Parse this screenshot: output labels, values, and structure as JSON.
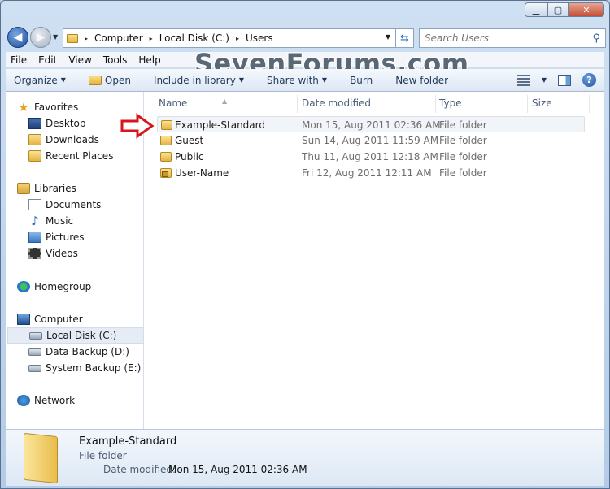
{
  "window": {
    "min_glyph": "▁",
    "max_glyph": "▢",
    "close_glyph": "✕"
  },
  "nav": {
    "back_glyph": "◀",
    "forward_glyph": "▶"
  },
  "address": {
    "crumbs": [
      "Computer",
      "Local Disk (C:)",
      "Users"
    ],
    "separator": "▸"
  },
  "search": {
    "placeholder": "Search Users"
  },
  "menu": [
    "File",
    "Edit",
    "View",
    "Tools",
    "Help"
  ],
  "watermark": "SevenForums.com",
  "toolbar": {
    "organize": "Organize",
    "open": "Open",
    "include": "Include in library",
    "share": "Share with",
    "burn": "Burn",
    "new_folder": "New folder",
    "help": "?"
  },
  "navpane": {
    "favorites": "Favorites",
    "desktop": "Desktop",
    "downloads": "Downloads",
    "recent": "Recent Places",
    "libraries": "Libraries",
    "documents": "Documents",
    "music": "Music",
    "pictures": "Pictures",
    "videos": "Videos",
    "homegroup": "Homegroup",
    "computer": "Computer",
    "local_disk": "Local Disk (C:)",
    "data_backup": "Data Backup (D:)",
    "system_backup": "System Backup (E:)",
    "network": "Network"
  },
  "columns": {
    "name": "Name",
    "date": "Date modified",
    "type": "Type",
    "size": "Size"
  },
  "files": [
    {
      "name": "Example-Standard",
      "date": "Mon 15, Aug 2011 02:36 AM",
      "type": "File folder"
    },
    {
      "name": "Guest",
      "date": "Sun 14, Aug 2011 11:59 AM",
      "type": "File folder"
    },
    {
      "name": "Public",
      "date": "Thu 11, Aug 2011 12:18 AM",
      "type": "File folder"
    },
    {
      "name": "User-Name",
      "date": "Fri 12, Aug 2011 12:11 AM",
      "type": "File folder"
    }
  ],
  "details": {
    "name": "Example-Standard",
    "type": "File folder",
    "modified_label": "Date modified:",
    "modified_value": "Mon 15, Aug 2011 02:36 AM"
  },
  "colors": {
    "arrow_red": "#d9141b"
  }
}
